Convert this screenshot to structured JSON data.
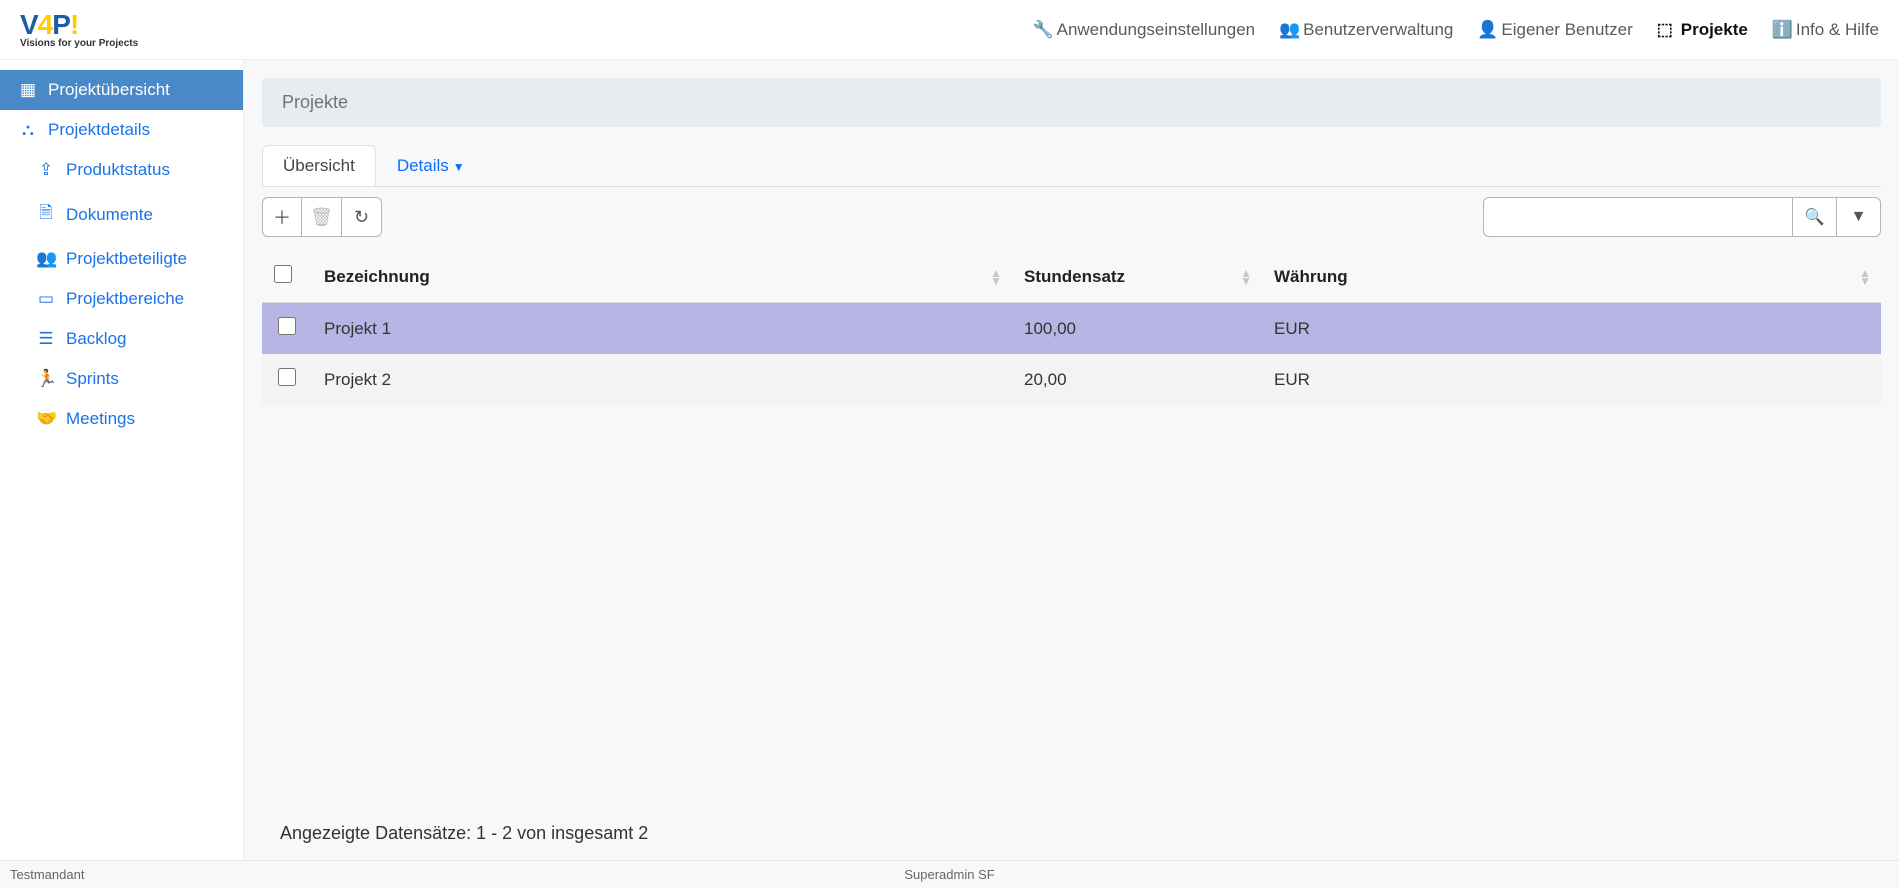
{
  "header": {
    "logo_letters": {
      "v": "V",
      "four": "4",
      "p": "P",
      "ex": "!"
    },
    "logo_sub": "Visions for your Projects",
    "nav": {
      "settings": "Anwendungseinstellungen",
      "users": "Benutzerverwaltung",
      "ownuser": "Eigener Benutzer",
      "projects": "Projekte",
      "info": "Info & Hilfe"
    }
  },
  "sidebar": {
    "overview": "Projektübersicht",
    "details": "Projektdetails",
    "status": "Produktstatus",
    "docs": "Dokumente",
    "stakeholders": "Projektbeteiligte",
    "areas": "Projektbereiche",
    "backlog": "Backlog",
    "sprints": "Sprints",
    "meetings": "Meetings"
  },
  "page": {
    "title": "Projekte",
    "tab_overview": "Übersicht",
    "tab_details": "Details"
  },
  "table": {
    "cols": {
      "bezeichnung": "Bezeichnung",
      "stundensatz": "Stundensatz",
      "waehrung": "Währung"
    },
    "rows": [
      {
        "bezeichnung": "Projekt 1",
        "stundensatz": "100,00",
        "waehrung": "EUR"
      },
      {
        "bezeichnung": "Projekt 2",
        "stundensatz": "20,00",
        "waehrung": "EUR"
      }
    ]
  },
  "footer": {
    "count_text": "Angezeigte Datensätze: 1 - 2 von insgesamt 2",
    "tenant": "Testmandant",
    "user": "Superadmin SF"
  }
}
